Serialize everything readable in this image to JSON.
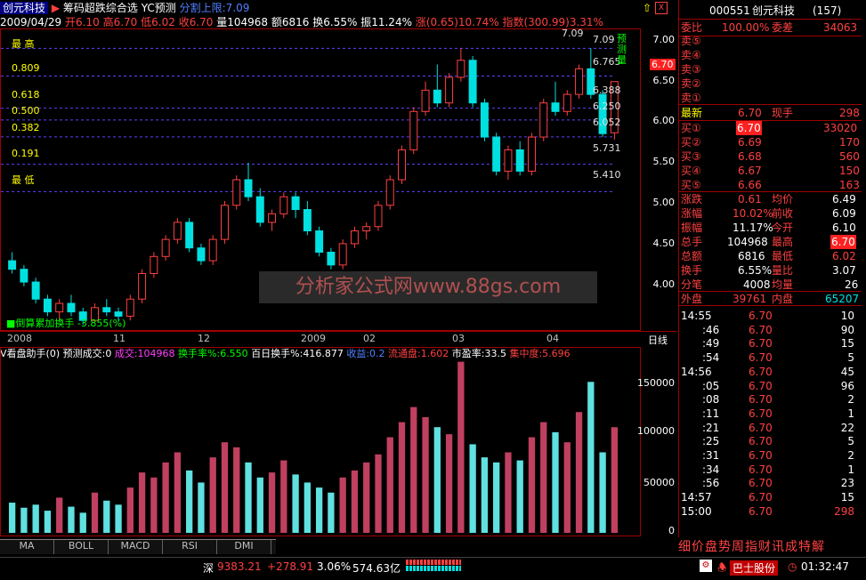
{
  "title": {
    "stock_name": "创元科技",
    "formula": "筹码超跌综合选",
    "yc": "YC预测",
    "split_limit": "分割上限:7.09"
  },
  "info": {
    "date": "2009/04/29",
    "open": "开6.10",
    "high": "高6.70",
    "low": "低6.02",
    "close": "收6.70",
    "volume": "量104968",
    "amount": "额6816",
    "turnover": "换6.55%",
    "amplitude": "振11.24%",
    "change": "涨(0.65)10.74%",
    "index": "指数(300.99)3.31%"
  },
  "fib_labels": [
    "最 高",
    "0.809",
    "0.618",
    "0.500",
    "0.382",
    "0.191",
    "最 低"
  ],
  "fib_right_values": [
    "7.09",
    "6.765",
    "6.388",
    "6.250",
    "6.052",
    "5.731",
    "5.410"
  ],
  "yc_label": "预测量",
  "price_axis": [
    "7.00",
    "6.50",
    "6.00",
    "5.50",
    "5.00",
    "4.50",
    "4.00"
  ],
  "current_price_tag": "6.70",
  "peak_label": "7.09",
  "bottom_legend": "倒算累加换手 -3.855(%)",
  "watermark": "分析家公式网www.88gs.com",
  "date_axis": [
    "2008",
    "11",
    "12",
    "2009",
    "02",
    "03",
    "04"
  ],
  "date_axis_label": "日线",
  "indicator": {
    "name": "V看盘助手(0)",
    "yc_vol": "预测成交:0",
    "vol": "成交:104968",
    "turnover": "换手率%:6.550",
    "hundred_turn": "百日换手%:416.877",
    "profit": "收益:0.2",
    "circ": "流通盘:1.602",
    "pe": "市盈率:33.5",
    "conc": "集中度:5.696"
  },
  "vol_axis": [
    "150000",
    "100000",
    "50000",
    "0"
  ],
  "tabs": [
    "MA",
    "BOLL",
    "MACD",
    "RSI",
    "DMI"
  ],
  "status": {
    "index_name": "深",
    "index_value": "9383.21",
    "index_change": "+278.91",
    "index_pct": "3.06%",
    "amount": "574.63亿",
    "stock_ticker": "巴士股份",
    "time": "01:32:47"
  },
  "quote": {
    "code": "000551",
    "name": "创元科技",
    "num": "(157)",
    "weibi_label": "委比",
    "weibi": "100.00%",
    "weicha_label": "委差",
    "weicha": "34063",
    "sells": [
      "卖⑤",
      "卖④",
      "卖③",
      "卖②",
      "卖①"
    ],
    "latest_label": "最新",
    "latest": "6.70",
    "xianshou_label": "现手",
    "xianshou": "298",
    "buys": [
      {
        "label": "买①",
        "price": "6.70",
        "vol": "33020"
      },
      {
        "label": "买②",
        "price": "6.69",
        "vol": "170"
      },
      {
        "label": "买③",
        "price": "6.68",
        "vol": "560"
      },
      {
        "label": "买④",
        "price": "6.67",
        "vol": "150"
      },
      {
        "label": "买⑤",
        "price": "6.66",
        "vol": "163"
      }
    ],
    "stats": [
      {
        "l1": "涨跌",
        "v1": "0.61",
        "l2": "均价",
        "v2": "6.49"
      },
      {
        "l1": "涨幅",
        "v1": "10.02%",
        "l2": "前收",
        "v2": "6.09"
      },
      {
        "l1": "振幅",
        "v1": "11.17%",
        "l2": "今开",
        "v2": "6.10"
      },
      {
        "l1": "总手",
        "v1": "104968",
        "l2": "最高",
        "v2": "6.70"
      },
      {
        "l1": "总额",
        "v1": "6816",
        "l2": "最低",
        "v2": "6.02"
      },
      {
        "l1": "换手",
        "v1": "6.55%",
        "l2": "量比",
        "v2": "3.07"
      },
      {
        "l1": "分笔",
        "v1": "4008",
        "l2": "均量",
        "v2": "26"
      }
    ],
    "waipan_label": "外盘",
    "waipan": "39761",
    "neipan_label": "内盘",
    "neipan": "65207",
    "ticks": [
      {
        "t": "14:55",
        "p": "6.70",
        "v": "10"
      },
      {
        "t": ":46",
        "p": "6.70",
        "v": "90"
      },
      {
        "t": ":49",
        "p": "6.70",
        "v": "15"
      },
      {
        "t": ":54",
        "p": "6.70",
        "v": "5"
      },
      {
        "t": "14:56",
        "p": "6.70",
        "v": "45"
      },
      {
        "t": ":05",
        "p": "6.70",
        "v": "96"
      },
      {
        "t": ":08",
        "p": "6.70",
        "v": "2"
      },
      {
        "t": ":11",
        "p": "6.70",
        "v": "1"
      },
      {
        "t": ":21",
        "p": "6.70",
        "v": "22"
      },
      {
        "t": ":25",
        "p": "6.70",
        "v": "5"
      },
      {
        "t": ":31",
        "p": "6.70",
        "v": "2"
      },
      {
        "t": ":34",
        "p": "6.70",
        "v": "1"
      },
      {
        "t": ":56",
        "p": "6.70",
        "v": "23"
      },
      {
        "t": "14:57",
        "p": "6.70",
        "v": "15"
      },
      {
        "t": "15:00",
        "p": "6.70",
        "v": "298"
      }
    ]
  },
  "right_tabs": "细价盘势周指财讯成特解",
  "colors": {
    "up": "#ff4040",
    "down": "#00e0e0",
    "frame": "#a00000"
  },
  "chart_data": {
    "type": "candlestick",
    "ylim": [
      3.85,
      7.25
    ],
    "candles": [
      [
        4.6,
        4.7,
        4.45,
        4.5
      ],
      [
        4.5,
        4.55,
        4.3,
        4.35
      ],
      [
        4.35,
        4.4,
        4.1,
        4.15
      ],
      [
        4.15,
        4.2,
        3.95,
        4.0
      ],
      [
        4.0,
        4.15,
        3.9,
        4.1
      ],
      [
        4.1,
        4.2,
        3.95,
        4.0
      ],
      [
        4.0,
        4.05,
        3.85,
        3.9
      ],
      [
        3.9,
        4.1,
        3.88,
        4.05
      ],
      [
        4.05,
        4.15,
        3.95,
        4.0
      ],
      [
        4.0,
        4.05,
        3.9,
        3.95
      ],
      [
        3.95,
        4.2,
        3.9,
        4.15
      ],
      [
        4.15,
        4.5,
        4.1,
        4.45
      ],
      [
        4.45,
        4.7,
        4.4,
        4.65
      ],
      [
        4.65,
        4.9,
        4.6,
        4.85
      ],
      [
        4.85,
        5.1,
        4.8,
        5.05
      ],
      [
        5.05,
        5.1,
        4.7,
        4.75
      ],
      [
        4.75,
        4.8,
        4.55,
        4.6
      ],
      [
        4.6,
        4.9,
        4.55,
        4.85
      ],
      [
        4.85,
        5.3,
        4.8,
        5.25
      ],
      [
        5.25,
        5.6,
        5.2,
        5.55
      ],
      [
        5.55,
        5.75,
        5.3,
        5.35
      ],
      [
        5.35,
        5.45,
        5.0,
        5.05
      ],
      [
        5.05,
        5.2,
        4.95,
        5.15
      ],
      [
        5.15,
        5.4,
        5.1,
        5.35
      ],
      [
        5.35,
        5.4,
        5.1,
        5.2
      ],
      [
        5.2,
        5.3,
        4.9,
        4.95
      ],
      [
        4.95,
        5.0,
        4.65,
        4.7
      ],
      [
        4.7,
        4.75,
        4.5,
        4.55
      ],
      [
        4.55,
        4.85,
        4.5,
        4.8
      ],
      [
        4.8,
        5.0,
        4.75,
        4.95
      ],
      [
        4.95,
        5.05,
        4.85,
        5.0
      ],
      [
        5.0,
        5.3,
        4.95,
        5.25
      ],
      [
        5.25,
        5.6,
        5.2,
        5.55
      ],
      [
        5.55,
        5.95,
        5.5,
        5.9
      ],
      [
        5.9,
        6.4,
        5.85,
        6.35
      ],
      [
        6.35,
        6.7,
        6.3,
        6.6
      ],
      [
        6.6,
        6.9,
        6.4,
        6.45
      ],
      [
        6.45,
        6.8,
        6.4,
        6.75
      ],
      [
        6.75,
        7.09,
        6.7,
        6.95
      ],
      [
        6.95,
        7.0,
        6.4,
        6.45
      ],
      [
        6.45,
        6.5,
        6.0,
        6.05
      ],
      [
        6.05,
        6.1,
        5.6,
        5.65
      ],
      [
        5.65,
        5.95,
        5.55,
        5.9
      ],
      [
        5.9,
        6.0,
        5.6,
        5.65
      ],
      [
        5.65,
        6.1,
        5.6,
        6.05
      ],
      [
        6.05,
        6.5,
        6.0,
        6.45
      ],
      [
        6.45,
        6.7,
        6.3,
        6.35
      ],
      [
        6.35,
        6.6,
        6.3,
        6.55
      ],
      [
        6.55,
        6.9,
        6.5,
        6.85
      ],
      [
        6.85,
        7.09,
        6.5,
        6.55
      ],
      [
        6.55,
        6.6,
        6.05,
        6.09
      ],
      [
        6.1,
        6.7,
        6.02,
        6.7
      ]
    ],
    "volumes": [
      30,
      25,
      28,
      22,
      35,
      26,
      20,
      40,
      32,
      28,
      45,
      60,
      55,
      70,
      80,
      62,
      50,
      75,
      90,
      85,
      70,
      55,
      60,
      72,
      58,
      50,
      45,
      40,
      55,
      62,
      70,
      78,
      95,
      110,
      125,
      115,
      105,
      98,
      170,
      88,
      75,
      70,
      80,
      72,
      95,
      110,
      100,
      90,
      120,
      150,
      80,
      105
    ],
    "vol_ylim": [
      0,
      175
    ]
  }
}
